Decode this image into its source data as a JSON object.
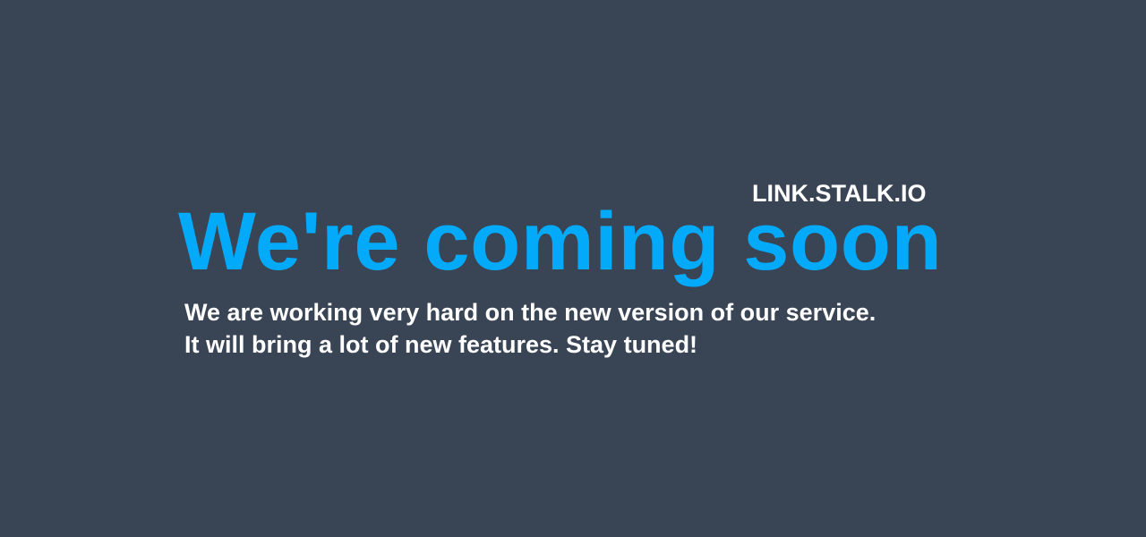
{
  "site_name": "LINK.STALK.IO",
  "headline": "We're coming soon",
  "message": {
    "line1": "We are working very hard on the new version of our service.",
    "line2": "It will bring a lot of new features. Stay tuned!"
  },
  "colors": {
    "background": "#394455",
    "accent": "#03aafa",
    "text": "#ffffff"
  }
}
